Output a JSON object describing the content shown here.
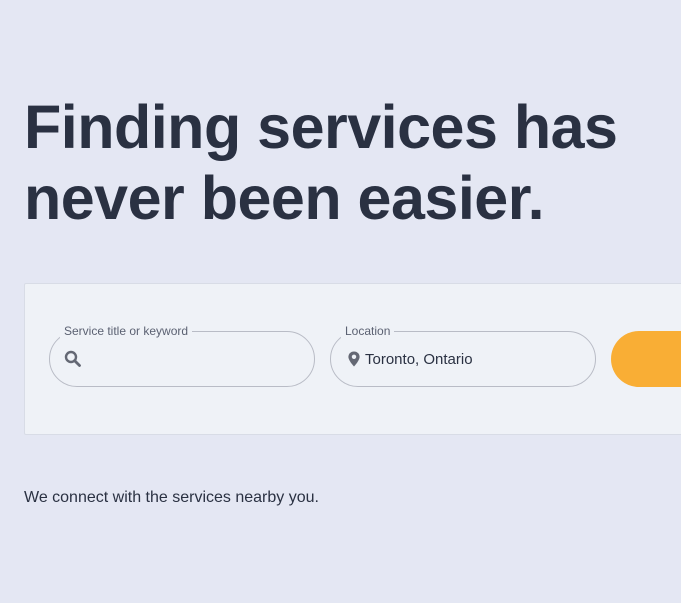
{
  "hero": {
    "title_line1": "Finding services has",
    "title_line2": "never been easier."
  },
  "search": {
    "keyword": {
      "label": "Service title or keyword",
      "value": "",
      "placeholder": "",
      "icon": "search-icon"
    },
    "location": {
      "label": "Location",
      "value": "Toronto, Ontario",
      "icon": "location-pin-icon"
    },
    "button": {
      "label": "",
      "color": "#f9ae35"
    }
  },
  "tagline": "We connect with the services nearby you.",
  "colors": {
    "background": "#e4e7f3",
    "card": "#eff2f7",
    "text": "#2a3142",
    "accent": "#f9ae35"
  }
}
